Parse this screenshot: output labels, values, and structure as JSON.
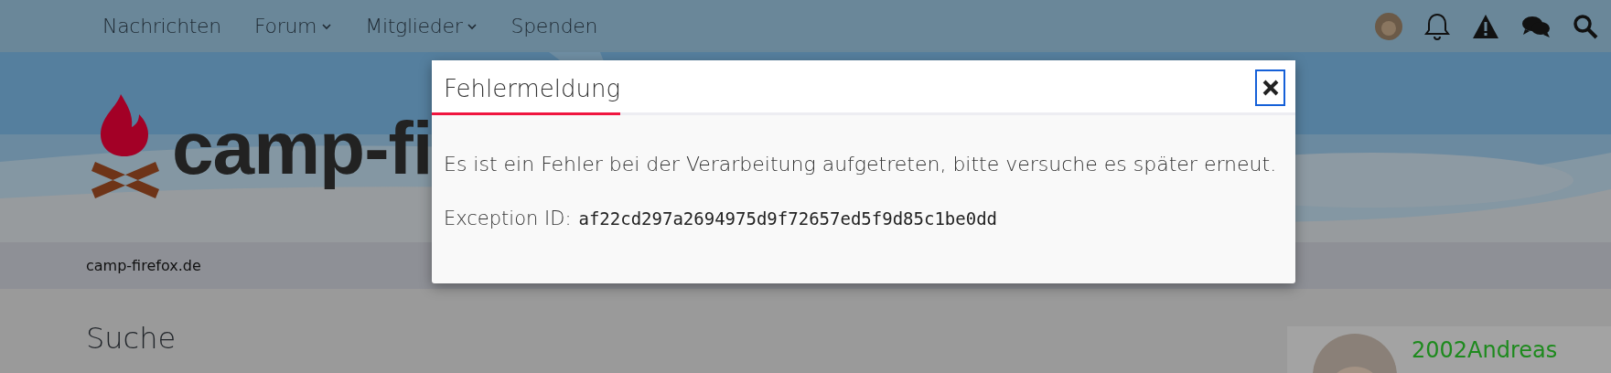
{
  "nav": {
    "items": [
      {
        "label": "Nachrichten",
        "dropdown": false
      },
      {
        "label": "Forum",
        "dropdown": true
      },
      {
        "label": "Mitglieder",
        "dropdown": true
      },
      {
        "label": "Spenden",
        "dropdown": false
      }
    ]
  },
  "logo": {
    "text": "camp-fi"
  },
  "breadcrumb": "camp-firefox.de",
  "page_title": "Suche",
  "user_card": {
    "name": "2002Andreas"
  },
  "dialog": {
    "title": "Fehlermeldung",
    "message": "Es ist ein Fehler bei der Verarbeitung aufgetreten, bitte versuche es später erneut.",
    "exception_label": "Exception ID:",
    "exception_id": "af22cd297a2694975d9f72657ed5f9d85c1be0dd"
  }
}
